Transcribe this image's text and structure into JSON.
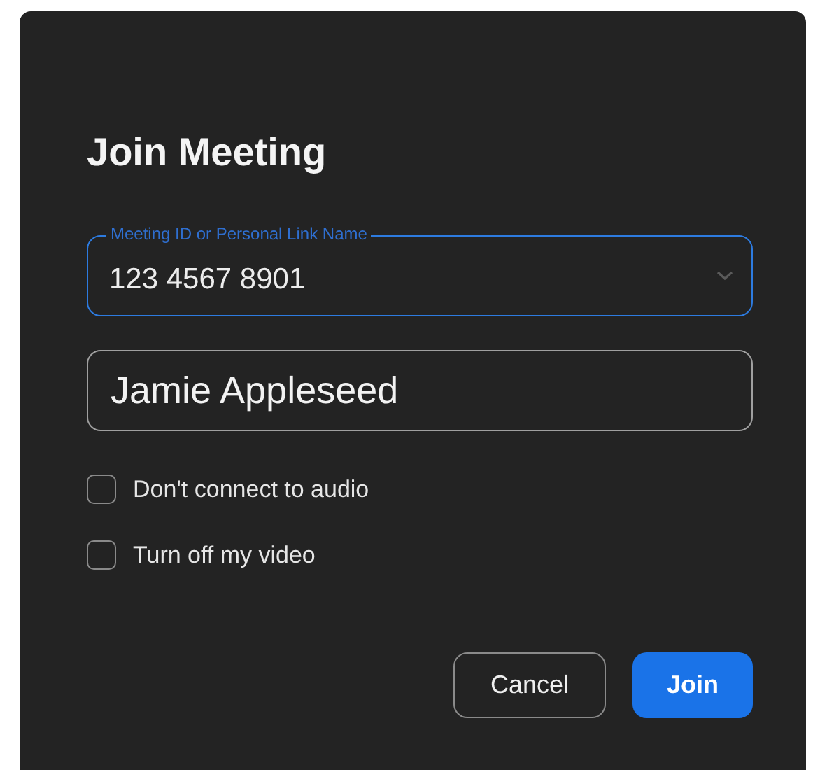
{
  "dialog": {
    "title": "Join Meeting"
  },
  "meeting_field": {
    "label": "Meeting ID or Personal Link Name",
    "value": "123 4567 8901",
    "focused": true
  },
  "name_field": {
    "value": "Jamie Appleseed"
  },
  "options": [
    {
      "label": "Don't connect to audio",
      "checked": false
    },
    {
      "label": "Turn off my video",
      "checked": false
    }
  ],
  "buttons": [
    {
      "label": "Cancel",
      "kind": "secondary"
    },
    {
      "label": "Join",
      "kind": "primary"
    }
  ]
}
